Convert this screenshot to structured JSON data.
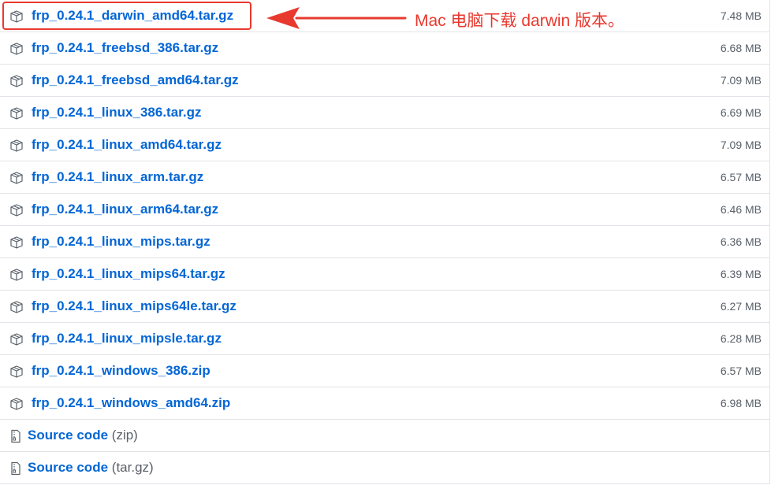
{
  "annotation": {
    "text": "Mac 电脑下载 darwin 版本。",
    "color": "#e8392f"
  },
  "assets": [
    {
      "name": "frp_0.24.1_darwin_amd64.tar.gz",
      "size": "7.48 MB",
      "icon": "package-icon"
    },
    {
      "name": "frp_0.24.1_freebsd_386.tar.gz",
      "size": "6.68 MB",
      "icon": "package-icon"
    },
    {
      "name": "frp_0.24.1_freebsd_amd64.tar.gz",
      "size": "7.09 MB",
      "icon": "package-icon"
    },
    {
      "name": "frp_0.24.1_linux_386.tar.gz",
      "size": "6.69 MB",
      "icon": "package-icon"
    },
    {
      "name": "frp_0.24.1_linux_amd64.tar.gz",
      "size": "7.09 MB",
      "icon": "package-icon"
    },
    {
      "name": "frp_0.24.1_linux_arm.tar.gz",
      "size": "6.57 MB",
      "icon": "package-icon"
    },
    {
      "name": "frp_0.24.1_linux_arm64.tar.gz",
      "size": "6.46 MB",
      "icon": "package-icon"
    },
    {
      "name": "frp_0.24.1_linux_mips.tar.gz",
      "size": "6.36 MB",
      "icon": "package-icon"
    },
    {
      "name": "frp_0.24.1_linux_mips64.tar.gz",
      "size": "6.39 MB",
      "icon": "package-icon"
    },
    {
      "name": "frp_0.24.1_linux_mips64le.tar.gz",
      "size": "6.27 MB",
      "icon": "package-icon"
    },
    {
      "name": "frp_0.24.1_linux_mipsle.tar.gz",
      "size": "6.28 MB",
      "icon": "package-icon"
    },
    {
      "name": "frp_0.24.1_windows_386.zip",
      "size": "6.57 MB",
      "icon": "package-icon"
    },
    {
      "name": "frp_0.24.1_windows_amd64.zip",
      "size": "6.98 MB",
      "icon": "package-icon"
    }
  ],
  "source": [
    {
      "label": "Source code",
      "ext": "(zip)",
      "icon": "file-zip-icon"
    },
    {
      "label": "Source code",
      "ext": "(tar.gz)",
      "icon": "file-zip-icon"
    }
  ],
  "colors": {
    "link": "#0366d6",
    "muted": "#586069",
    "border": "#e1e4e8",
    "highlight": "#e8392f"
  }
}
